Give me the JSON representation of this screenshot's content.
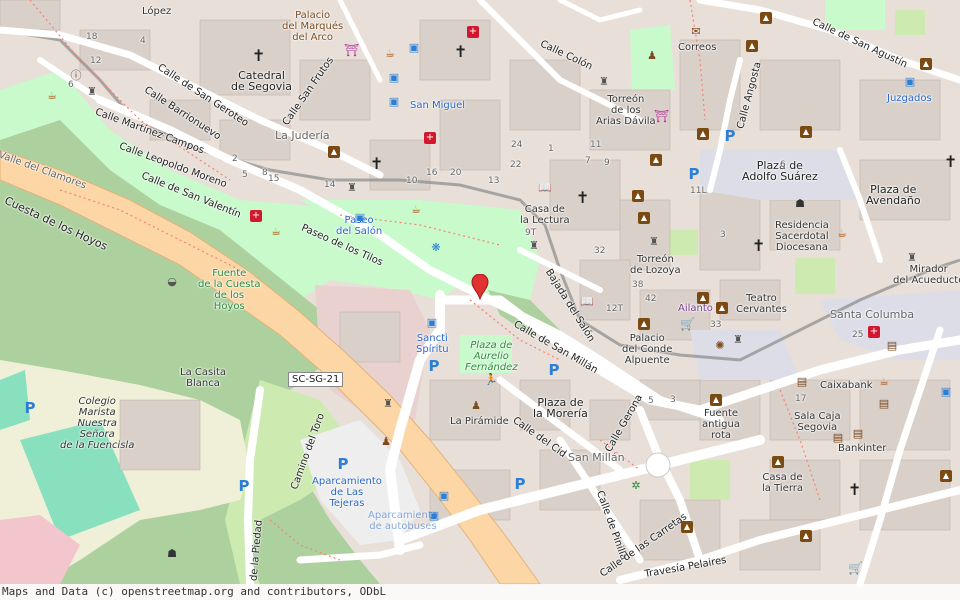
{
  "map": {
    "streets": [
      {
        "id": "calle-san-geroteo",
        "text": "Calle de San Geroteo"
      },
      {
        "id": "calle-barrionuevo",
        "text": "Calle Barrionuevo"
      },
      {
        "id": "calle-martinez-campos",
        "text": "Calle Martínez Campos"
      },
      {
        "id": "calle-leopoldo-moreno",
        "text": "Calle Leopoldo Moreno"
      },
      {
        "id": "calle-san-valentin",
        "text": "Calle de San Valentín"
      },
      {
        "id": "valle-clamores",
        "text": "Valle del Clamores"
      },
      {
        "id": "cuesta-hoyos",
        "text": "Cuesta de los Hoyos"
      },
      {
        "id": "paseo-tilos",
        "text": "Paseo de los Tilos"
      },
      {
        "id": "calle-san-frutos",
        "text": "Calle San Frutos"
      },
      {
        "id": "calle-colon",
        "text": "Calle Colón"
      },
      {
        "id": "calle-angosta",
        "text": "Calle Angosta"
      },
      {
        "id": "calle-san-agustin",
        "text": "Calle de San Agustín"
      },
      {
        "id": "bajada-salon",
        "text": "Bajada del Salón"
      },
      {
        "id": "calle-san-millan",
        "text": "Calle de San Millán"
      },
      {
        "id": "calle-cid",
        "text": "Calle del Cid"
      },
      {
        "id": "calle-gerona",
        "text": "Calle Gerona"
      },
      {
        "id": "camino-toro",
        "text": "Camino del Toro"
      },
      {
        "id": "calle-piedad",
        "text": "de la Piedad"
      },
      {
        "id": "calle-pinilla",
        "text": "Calle de Pinilla"
      },
      {
        "id": "calle-carretas",
        "text": "Calle de las Carretas"
      },
      {
        "id": "travesia-pelaires",
        "text": "Travesía Pelaires"
      },
      {
        "id": "road-ref",
        "text": "SC-SG-21"
      }
    ],
    "places": [
      {
        "id": "catedral",
        "line1": "Catedral",
        "line2": "de Segovia"
      },
      {
        "id": "palacio-marques",
        "line1": "Palacio",
        "line2": "del Marqués",
        "line3": "del Arco"
      },
      {
        "id": "juderia",
        "line1": "La Judería"
      },
      {
        "id": "san-miguel",
        "line1": "San Miguel"
      },
      {
        "id": "torreon-arias",
        "line1": "Torreón",
        "line2": "de los",
        "line3": "Arias Dávila"
      },
      {
        "id": "correos",
        "line1": "Correos"
      },
      {
        "id": "juzgados",
        "line1": "Juzgados"
      },
      {
        "id": "plaza-adolfo",
        "line1": "Plaza de",
        "line2": "Adolfo Suárez"
      },
      {
        "id": "plaza-avendano",
        "line1": "Plaza de",
        "line2": "Avendaño"
      },
      {
        "id": "residencia",
        "line1": "Residencia",
        "line2": "Sacerdotal",
        "line3": "Diocesana"
      },
      {
        "id": "casa-lectura",
        "line1": "Casa de",
        "line2": "la Lectura"
      },
      {
        "id": "torreon-lozoya",
        "line1": "Torreón",
        "line2": "de Lozoya"
      },
      {
        "id": "teatro-cervantes",
        "line1": "Teatro",
        "line2": "Cervantes"
      },
      {
        "id": "ailanto",
        "line1": "Ailanto"
      },
      {
        "id": "santa-columba",
        "line1": "Santa Columba"
      },
      {
        "id": "mirador",
        "line1": "Mirador",
        "line2": "del Acueducto"
      },
      {
        "id": "paseo-salon",
        "line1": "Paseo",
        "line2": "del Salón"
      },
      {
        "id": "fuente-cuesta",
        "line1": "Fuente",
        "line2": "de la Cuesta",
        "line3": "de los",
        "line4": "Hoyos"
      },
      {
        "id": "sancti-spiritu",
        "line1": "Sancti",
        "line2": "Spíritu"
      },
      {
        "id": "plaza-aurelio",
        "line1": "Plaza de",
        "line2": "Aurelio",
        "line3": "Fernández"
      },
      {
        "id": "palacio-conde",
        "line1": "Palacio",
        "line2": "del Conde",
        "line3": "Alpuente"
      },
      {
        "id": "plaza-moreria",
        "line1": "Plaza de",
        "line2": "la Morería"
      },
      {
        "id": "la-piramide",
        "line1": "La Pirámide"
      },
      {
        "id": "san-millan",
        "line1": "San Millán"
      },
      {
        "id": "fuente-antigua",
        "line1": "Fuente",
        "line2": "antigua",
        "line3": "rota"
      },
      {
        "id": "caixabank",
        "line1": "Caixabank"
      },
      {
        "id": "sala-caja",
        "line1": "Sala Caja",
        "line2": "Segovia"
      },
      {
        "id": "bankinter",
        "line1": "Bankinter"
      },
      {
        "id": "casa-tierra",
        "line1": "Casa de",
        "line2": "la Tierra"
      },
      {
        "id": "casita-blanca",
        "line1": "La Casita",
        "line2": "Blanca"
      },
      {
        "id": "colegio",
        "line1": "Colegio",
        "line2": "Marista",
        "line3": "Nuestra",
        "line4": "Señora",
        "line5": "de la Fuencisla"
      },
      {
        "id": "aparcamiento",
        "line1": "Aparcamiento",
        "line2": "de Las",
        "line3": "Tejeras"
      },
      {
        "id": "aparcamiento-bus",
        "line1": "Aparcamiento",
        "line2": "de autobuses"
      },
      {
        "id": "lopez",
        "line1": "López"
      }
    ],
    "numbers": [
      "18",
      "12",
      "6",
      "4",
      "2",
      "8",
      "22",
      "13",
      "11",
      "9",
      "1",
      "5",
      "7",
      "15",
      "3",
      "10",
      "14",
      "24",
      "20",
      "16",
      "32",
      "38",
      "42",
      "12T",
      "25",
      "33",
      "9T",
      "11L",
      "6",
      "17",
      "5",
      "3"
    ],
    "attribution": "Maps and Data (c) openstreetmap.org and contributors, ODbL",
    "colors": {
      "background": "#e8dfd8",
      "building": "#d9d0c9",
      "park": "#c8facc",
      "wood": "#add19e",
      "primary_road": "#fcd6a4",
      "residential": "#ffffff",
      "pedestrian": "#dddde8",
      "pitch": "#88e0be",
      "marker": "#e03232"
    }
  }
}
